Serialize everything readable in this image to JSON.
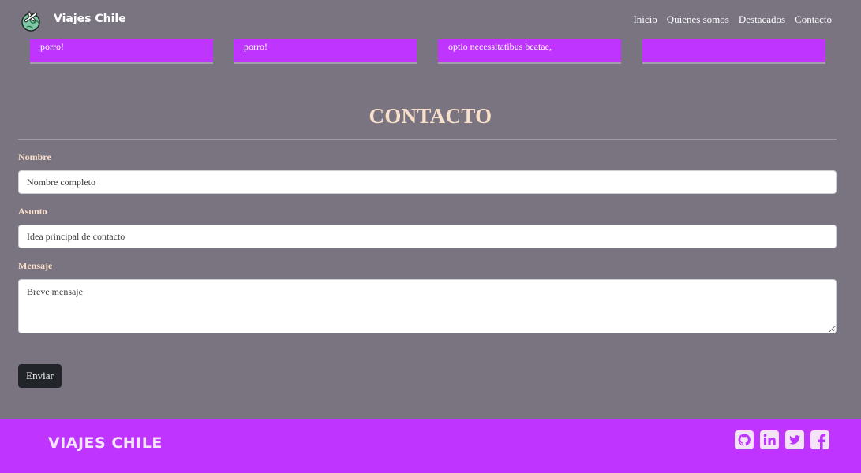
{
  "navbar": {
    "brand": "Viajes Chile",
    "logo_icon": "globe-plane-icon",
    "links": [
      "Inicio",
      "Quienes somos",
      "Destacados",
      "Contacto"
    ]
  },
  "cards": [
    {
      "text": "porro!"
    },
    {
      "text": "porro!"
    },
    {
      "text": "optio necessitatibus beatae,"
    },
    {
      "text": ""
    }
  ],
  "contact": {
    "title": "CONTACTO",
    "nombre_label": "Nombre",
    "nombre_placeholder": "Nombre completo",
    "asunto_label": "Asunto",
    "asunto_placeholder": "Idea principal de contacto",
    "mensaje_label": "Mensaje",
    "mensaje_placeholder": "Breve mensaje",
    "submit_label": "Enviar"
  },
  "footer": {
    "brand": "VIAJES CHILE",
    "social_icons": [
      "github-icon",
      "linkedin-icon",
      "twitter-icon",
      "facebook-icon"
    ]
  },
  "colors": {
    "background": "#7a7380",
    "accent": "#c034ff",
    "heading": "#f8dfc9",
    "button": "#212529"
  }
}
